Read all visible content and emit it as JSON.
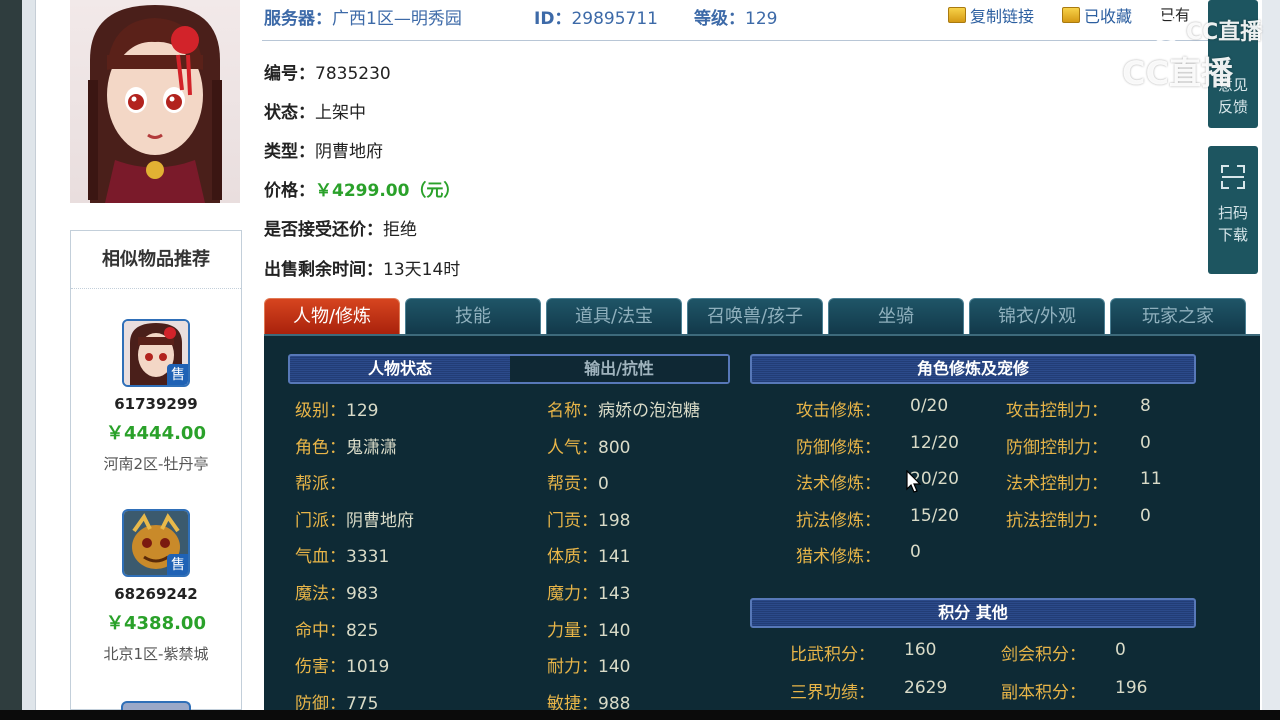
{
  "header": {
    "server_label": "服务器：",
    "server_value": "广西1区—明秀园",
    "id_label": "ID：",
    "id_value": "29895711",
    "level_label": "等级：",
    "level_value": "129",
    "copy_link": "复制链接",
    "favorited": "已收藏",
    "owned_text": "已有"
  },
  "watermark": {
    "text": "CC直播"
  },
  "info": {
    "serial": {
      "label": "编号：",
      "value": "7835230"
    },
    "status": {
      "label": "状态：",
      "value": "上架中"
    },
    "type": {
      "label": "类型：",
      "value": "阴曹地府"
    },
    "price": {
      "label": "价格：",
      "value": "￥4299.00（元）"
    },
    "counter_offer": {
      "label": "是否接受还价：",
      "value": "拒绝"
    },
    "time_left": {
      "label": "出售剩余时间：",
      "value": "13天14时"
    }
  },
  "side_widgets": {
    "feedback": [
      "意见",
      "反馈"
    ],
    "scan": [
      "扫码",
      "下载"
    ]
  },
  "similar": {
    "title": "相似物品推荐",
    "badge": "售",
    "items": [
      {
        "id": "61739299",
        "price": "￥4444.00",
        "server": "河南2区-牡丹亭"
      },
      {
        "id": "68269242",
        "price": "￥4388.00",
        "server": "北京1区-紫禁城"
      }
    ]
  },
  "tabs": [
    "人物/修炼",
    "技能",
    "道具/法宝",
    "召唤兽/孩子",
    "坐骑",
    "锦衣/外观",
    "玩家之家"
  ],
  "sections": {
    "char_status": "人物状态",
    "output_resist": "输出/抗性",
    "cultivation": "角色修炼及宠修",
    "points": "积分 其他"
  },
  "stats_left": [
    {
      "k": "级别：",
      "v": "129"
    },
    {
      "k": "角色：",
      "v": "鬼潇潇"
    },
    {
      "k": "帮派：",
      "v": ""
    },
    {
      "k": "门派：",
      "v": "阴曹地府"
    },
    {
      "k": "气血：",
      "v": "3331"
    },
    {
      "k": "魔法：",
      "v": "983"
    },
    {
      "k": "命中：",
      "v": "825"
    },
    {
      "k": "伤害：",
      "v": "1019"
    },
    {
      "k": "防御：",
      "v": "775"
    }
  ],
  "stats_mid": [
    {
      "k": "名称：",
      "v": "病娇の泡泡糖"
    },
    {
      "k": "人气：",
      "v": "800"
    },
    {
      "k": "帮贡：",
      "v": "0"
    },
    {
      "k": "门贡：",
      "v": "198"
    },
    {
      "k": "体质：",
      "v": "141"
    },
    {
      "k": "魔力：",
      "v": "143"
    },
    {
      "k": "力量：",
      "v": "140"
    },
    {
      "k": "耐力：",
      "v": "140"
    },
    {
      "k": "敏捷：",
      "v": "988"
    }
  ],
  "cultivation": [
    {
      "k": "攻击修炼：",
      "v": "0/20"
    },
    {
      "k": "防御修炼：",
      "v": "12/20"
    },
    {
      "k": "法术修炼：",
      "v": "20/20"
    },
    {
      "k": "抗法修炼：",
      "v": "15/20"
    },
    {
      "k": "猎术修炼：",
      "v": "0"
    }
  ],
  "control": [
    {
      "k": "攻击控制力：",
      "v": "8"
    },
    {
      "k": "防御控制力：",
      "v": "0"
    },
    {
      "k": "法术控制力：",
      "v": "11"
    },
    {
      "k": "抗法控制力：",
      "v": "0"
    }
  ],
  "points_left": [
    {
      "k": "比武积分：",
      "v": "160"
    },
    {
      "k": "三界功绩：",
      "v": "2629"
    }
  ],
  "points_right": [
    {
      "k": "剑会积分：",
      "v": "0"
    },
    {
      "k": "副本积分：",
      "v": "196"
    }
  ]
}
